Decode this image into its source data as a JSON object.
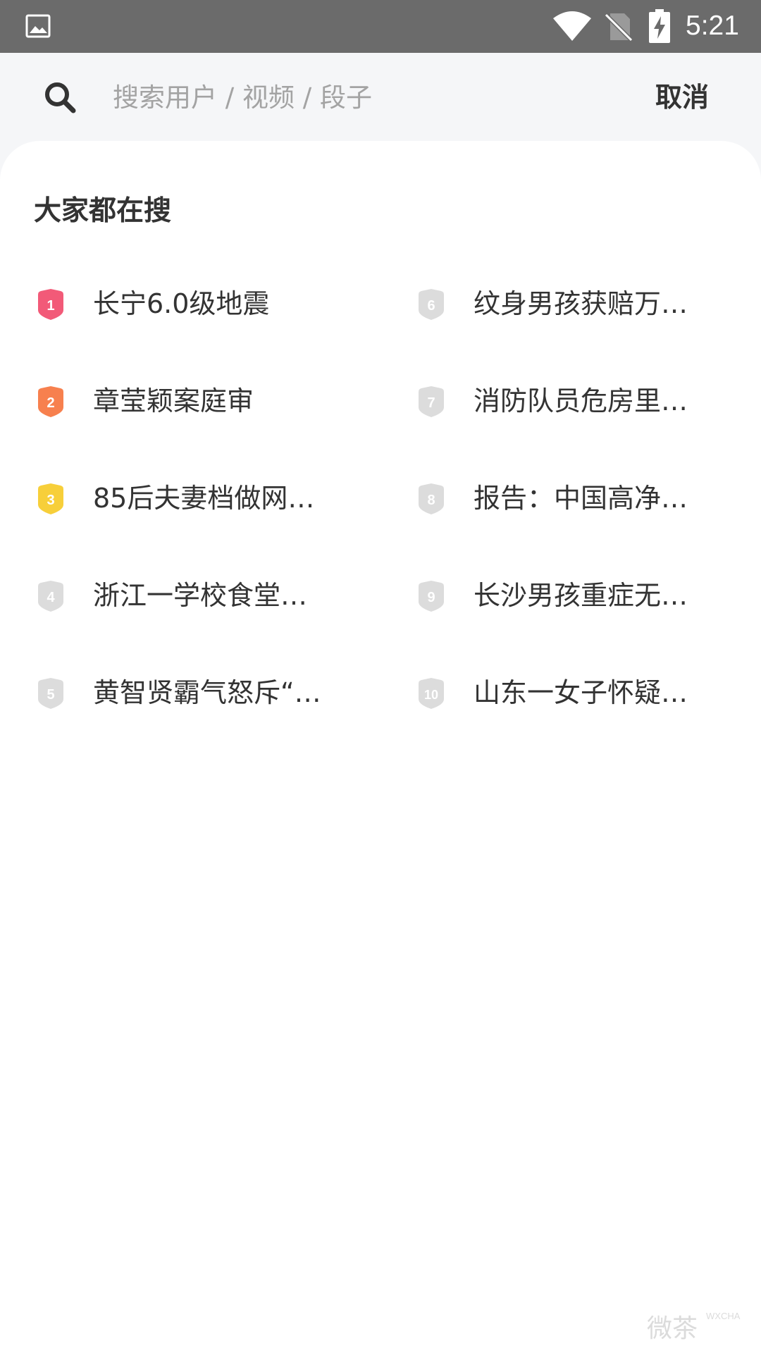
{
  "status_bar": {
    "time": "5:21",
    "icons": [
      "gallery-icon",
      "wifi-icon",
      "no-sim-icon",
      "battery-charging-icon"
    ]
  },
  "search": {
    "placeholder": "搜索用户 / 视频 / 段子",
    "value": "",
    "cancel_label": "取消",
    "icon": "search-icon"
  },
  "trending": {
    "title": "大家都在搜",
    "items": [
      {
        "rank": "1",
        "text": "长宁6.0级地震",
        "badge_color": "#f25a78"
      },
      {
        "rank": "2",
        "text": "章莹颖案庭审",
        "badge_color": "#f7804e"
      },
      {
        "rank": "3",
        "text": "85后夫妻档做网…",
        "badge_color": "#f7cf3a"
      },
      {
        "rank": "4",
        "text": "浙江一学校食堂…",
        "badge_color": "#dcdcdc"
      },
      {
        "rank": "5",
        "text": "黄智贤霸气怒斥“…",
        "badge_color": "#dcdcdc"
      },
      {
        "rank": "6",
        "text": "纹身男孩获赔万…",
        "badge_color": "#dcdcdc"
      },
      {
        "rank": "7",
        "text": "消防队员危房里…",
        "badge_color": "#dcdcdc"
      },
      {
        "rank": "8",
        "text": "报告：中国高净…",
        "badge_color": "#dcdcdc"
      },
      {
        "rank": "9",
        "text": "长沙男孩重症无…",
        "badge_color": "#dcdcdc"
      },
      {
        "rank": "10",
        "text": "山东一女子怀疑…",
        "badge_color": "#dcdcdc"
      }
    ]
  },
  "watermark": {
    "text": "微茶",
    "subtext": "WXCHA"
  },
  "colors": {
    "status_bar": "#6b6b6b",
    "header_bg": "#f5f6f8",
    "card_bg": "#ffffff",
    "text": "#333333",
    "placeholder": "#a3a3a3"
  }
}
